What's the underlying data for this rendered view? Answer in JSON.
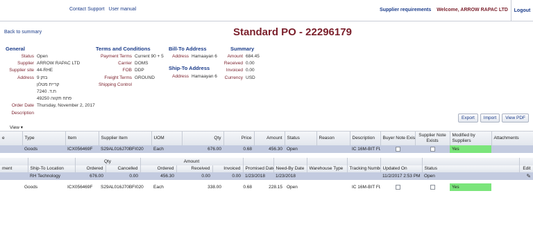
{
  "topbar": {
    "contact_support": "Contact Support",
    "user_manual": "User manual",
    "supplier_requirements": "Supplier requirements",
    "welcome": "Welcome, ARROW RAPAC LTD",
    "logout": "Logout"
  },
  "back_link": "Back to summary",
  "page_title": "Standard PO - 22296179",
  "general": {
    "heading": "General",
    "rows": [
      {
        "k": "Status",
        "v": "Open"
      },
      {
        "k": "Supplier",
        "v": "ARROW RAPAC LTD"
      },
      {
        "k": "Supplier site",
        "v": "44-RHE"
      },
      {
        "k": "Address",
        "v": "בזק 9"
      },
      {
        "k": "",
        "v": "קריית מטלון"
      },
      {
        "k": "",
        "v": "ת.ד. 7240"
      },
      {
        "k": "",
        "v": "49250 פתח תקווה"
      },
      {
        "k": "Order Date",
        "v": "Thursday, November 2, 2017"
      },
      {
        "k": "Description",
        "v": ""
      }
    ]
  },
  "terms": {
    "heading": "Terms and Conditions",
    "rows": [
      {
        "k": "Payment Terms",
        "v": "Current 90 + 5"
      },
      {
        "k": "Carrier",
        "v": "DOMS"
      },
      {
        "k": "FOB",
        "v": "DDP"
      },
      {
        "k": "Freight Terms",
        "v": "GROUND"
      },
      {
        "k": "Shipping Control",
        "v": ""
      }
    ]
  },
  "bill_to": {
    "heading": "Bill-To Address",
    "rows": [
      {
        "k": "Address",
        "v": "Hamaayan 6"
      }
    ]
  },
  "ship_to": {
    "heading": "Ship-To Address",
    "rows": [
      {
        "k": "Address",
        "v": "Hamaayan 6"
      }
    ]
  },
  "summary": {
    "heading": "Summary",
    "rows": [
      {
        "k": "Amount",
        "v": "684.45"
      },
      {
        "k": "Received",
        "v": "0.00"
      },
      {
        "k": "Invoiced",
        "v": "0.00"
      },
      {
        "k": "Currency",
        "v": "USD"
      }
    ]
  },
  "buttons": {
    "export": "Export",
    "import": "Import",
    "view_pdf": "View PDF"
  },
  "view_menu": "View ▾",
  "lines_table": {
    "headers": [
      "e",
      "Type",
      "Item",
      "Supplier Item",
      "UOM",
      "Qty",
      "Price",
      "Amount",
      "Status",
      "Reason",
      "Description",
      "Buyer Note Exists",
      "Supplier Note Exists",
      "Modified by Suppliers",
      "Attachments"
    ],
    "row": [
      "",
      "Goods",
      "ICX056469F",
      "S29AL016J70BFI020",
      "Each",
      "676.00",
      "0.68",
      "456.30",
      "Open",
      "",
      "IC 16M-BIT FL...",
      "",
      "",
      "Yes",
      ""
    ]
  },
  "ship_table": {
    "group_headers": {
      "qty": "Qty",
      "amount": "Amount"
    },
    "headers": [
      "ment",
      "Ship-To Location",
      "Ordered",
      "Cancelled",
      "Ordered",
      "Received",
      "Invoiced",
      "Promised Date",
      "Need-By Date",
      "Warehouse Type",
      "Tracking Number",
      "Updated On",
      "Status",
      "Edit"
    ],
    "row": [
      "",
      "RH Technology",
      "676.00",
      "0.00",
      "456.30",
      "0.00",
      "0.00",
      "1/23/2018",
      "1/23/2018",
      "",
      "",
      "11/2/2017 2:53 PM",
      "Open",
      ""
    ]
  },
  "second_line": [
    "",
    "Goods",
    "ICX056469F",
    "S29AL016J70BFI020",
    "Each",
    "338.00",
    "0.68",
    "228.15",
    "Open",
    "",
    "IC 16M-BIT FL...",
    "",
    "",
    "Yes",
    ""
  ]
}
